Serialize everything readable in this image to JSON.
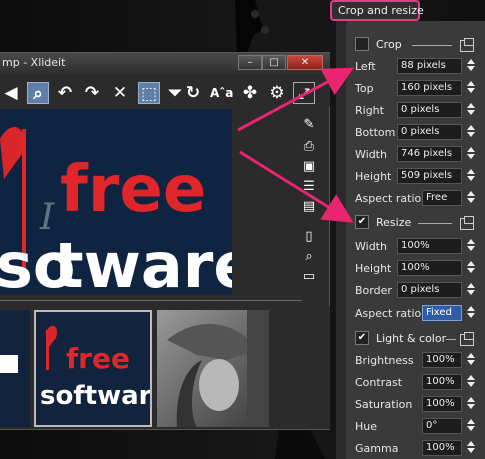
{
  "window": {
    "title": "mp - Xlideit",
    "min": "–",
    "max": "□",
    "close": "✕"
  },
  "toolbar": {
    "icons": [
      "◀",
      "⌕",
      "↶",
      "↷",
      "✕",
      "⬚",
      "⏷",
      "↻",
      "Aˆa",
      "✤",
      "⚙",
      "⤢"
    ]
  },
  "canvas_image": {
    "line1": "I",
    "line1b": "free",
    "line2": "so",
    "line2b": "tware"
  },
  "thumbs": {
    "logo_top": "free",
    "logo_bottom": "software",
    "logo_i": "I"
  },
  "panel": {
    "header": "Crop and resize",
    "crop": {
      "title": "Crop",
      "fields": [
        {
          "label": "Left",
          "value": "88 pixels"
        },
        {
          "label": "Top",
          "value": "160 pixels"
        },
        {
          "label": "Right",
          "value": "0 pixels"
        },
        {
          "label": "Bottom",
          "value": "0 pixels"
        },
        {
          "label": "Width",
          "value": "746 pixels"
        },
        {
          "label": "Height",
          "value": "509 pixels"
        }
      ],
      "aspect_label": "Aspect ratio",
      "aspect_value": "Free"
    },
    "resize": {
      "title": "Resize",
      "check": "✔",
      "fields": [
        {
          "label": "Width",
          "value": "100%"
        },
        {
          "label": "Height",
          "value": "100%"
        },
        {
          "label": "Border",
          "value": "0 pixels"
        }
      ],
      "aspect_label": "Aspect ratio",
      "aspect_value": "Fixed"
    },
    "light": {
      "title": "Light & color",
      "check": "✔",
      "fields": [
        {
          "label": "Brightness",
          "value": "100%"
        },
        {
          "label": "Contrast",
          "value": "100%"
        },
        {
          "label": "Saturation",
          "value": "100%"
        },
        {
          "label": "Hue",
          "value": "0°"
        },
        {
          "label": "Gamma",
          "value": "100%"
        }
      ]
    }
  },
  "colors": {
    "highlight_pink": "#e63c8c",
    "arrow_pink": "#e8256e",
    "selection_blue": "#2f5ba7"
  }
}
